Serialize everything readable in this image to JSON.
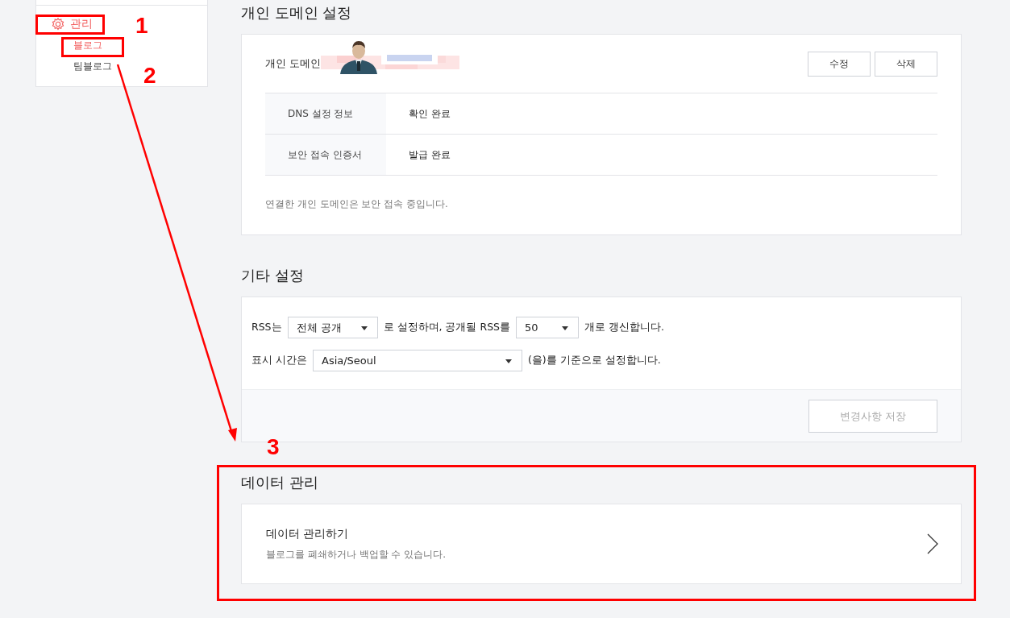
{
  "sidebar": {
    "items": [
      {
        "label": "관리",
        "selected": true,
        "children": [
          {
            "label": "블로그",
            "selected": true
          },
          {
            "label": "팀블로그",
            "selected": false
          }
        ]
      }
    ]
  },
  "domain_settings": {
    "title": "개인 도메인 설정",
    "label": "개인 도메인",
    "buttons": [
      {
        "label": "수정"
      },
      {
        "label": "삭제"
      }
    ],
    "rows": [
      {
        "name": "DNS 설정 정보",
        "value": "확인 완료"
      },
      {
        "name": "보안 접속 인증서",
        "value": "발급 완료"
      }
    ],
    "note": "연결한 개인 도메인은 보안 접속 중입니다."
  },
  "other_settings": {
    "title": "기타 설정",
    "rss": {
      "prefix": "RSS는",
      "visibility": "전체 공개",
      "middle": "로 설정하며, 공개될 RSS를",
      "count": "50",
      "suffix": "개로 갱신합니다."
    },
    "timezone": {
      "prefix": "표시 시간은",
      "value": "Asia/Seoul",
      "suffix": "(을)를 기준으로 설정합니다."
    },
    "save_button": {
      "label": "변경사항 저장",
      "disabled": true
    }
  },
  "data_management": {
    "title": "데이터 관리",
    "item": {
      "title": "데이터 관리하기",
      "description": "블로그를 폐쇄하거나 백업할 수 있습니다."
    }
  },
  "annotations": {
    "labels": [
      "1",
      "2",
      "3"
    ]
  }
}
